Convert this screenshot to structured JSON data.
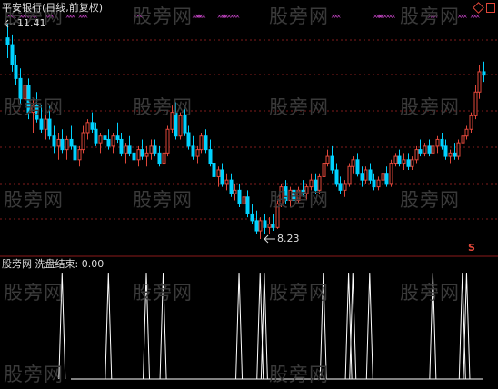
{
  "stock_title": "平安银行(日线,前复权)",
  "watermark": "股旁网",
  "indicator_label": "股旁网 洗盘结束: 0.00",
  "price_high_label": "11.41",
  "price_low_label": "8.23",
  "price_high": 11.41,
  "price_low": 8.23,
  "signal_marker": "S",
  "colors": {
    "up": "#e0473a",
    "down": "#00d2ff",
    "signal_top": "#d34bd3",
    "grid": "#7f1b1b",
    "indicator_line": "#ffffff",
    "watermark": "#3a3a3a"
  },
  "icons": [
    "diamond-icon",
    "square-icon"
  ],
  "chart_data": {
    "type": "candlestick",
    "title": "平安银行(日线,前复权)",
    "annotations": [
      "11.41",
      "8.23"
    ],
    "candles": [
      [
        11.2,
        11.41,
        10.9,
        11.1
      ],
      [
        11.1,
        11.25,
        10.7,
        10.8
      ],
      [
        10.8,
        10.95,
        10.5,
        10.6
      ],
      [
        10.6,
        10.75,
        10.2,
        10.3
      ],
      [
        10.3,
        10.6,
        10.2,
        10.5
      ],
      [
        10.5,
        10.6,
        10.0,
        10.1
      ],
      [
        10.1,
        10.3,
        9.8,
        10.2
      ],
      [
        10.2,
        10.4,
        9.95,
        10.0
      ],
      [
        10.0,
        10.2,
        9.8,
        9.85
      ],
      [
        9.85,
        10.1,
        9.7,
        10.0
      ],
      [
        10.0,
        10.2,
        9.7,
        9.75
      ],
      [
        9.75,
        9.9,
        9.5,
        9.6
      ],
      [
        9.6,
        9.8,
        9.4,
        9.7
      ],
      [
        9.7,
        9.85,
        9.5,
        9.55
      ],
      [
        9.55,
        9.75,
        9.4,
        9.7
      ],
      [
        9.7,
        9.9,
        9.55,
        9.6
      ],
      [
        9.6,
        9.75,
        9.35,
        9.4
      ],
      [
        9.4,
        9.6,
        9.3,
        9.55
      ],
      [
        9.55,
        9.9,
        9.5,
        9.8
      ],
      [
        9.8,
        10.0,
        9.7,
        9.95
      ],
      [
        9.95,
        10.1,
        9.8,
        9.85
      ],
      [
        9.85,
        9.95,
        9.6,
        9.65
      ],
      [
        9.65,
        9.8,
        9.5,
        9.75
      ],
      [
        9.75,
        9.9,
        9.6,
        9.7
      ],
      [
        9.7,
        9.85,
        9.55,
        9.6
      ],
      [
        9.6,
        9.8,
        9.5,
        9.75
      ],
      [
        9.75,
        9.95,
        9.65,
        9.7
      ],
      [
        9.7,
        9.8,
        9.45,
        9.5
      ],
      [
        9.5,
        9.65,
        9.35,
        9.6
      ],
      [
        9.6,
        9.75,
        9.45,
        9.5
      ],
      [
        9.5,
        9.6,
        9.3,
        9.4
      ],
      [
        9.4,
        9.6,
        9.3,
        9.55
      ],
      [
        9.55,
        9.7,
        9.4,
        9.45
      ],
      [
        9.45,
        9.6,
        9.3,
        9.5
      ],
      [
        9.5,
        9.7,
        9.4,
        9.6
      ],
      [
        9.6,
        9.7,
        9.45,
        9.5
      ],
      [
        9.5,
        9.6,
        9.3,
        9.35
      ],
      [
        9.35,
        9.55,
        9.3,
        9.5
      ],
      [
        9.5,
        9.9,
        9.45,
        9.85
      ],
      [
        9.85,
        10.2,
        9.8,
        10.1
      ],
      [
        10.1,
        10.25,
        9.7,
        9.75
      ],
      [
        9.75,
        10.1,
        9.7,
        10.05
      ],
      [
        10.05,
        10.15,
        9.75,
        9.8
      ],
      [
        9.8,
        9.9,
        9.55,
        9.6
      ],
      [
        9.6,
        9.75,
        9.4,
        9.45
      ],
      [
        9.45,
        9.6,
        9.35,
        9.55
      ],
      [
        9.55,
        9.8,
        9.5,
        9.75
      ],
      [
        9.75,
        9.85,
        9.5,
        9.55
      ],
      [
        9.55,
        9.7,
        9.3,
        9.35
      ],
      [
        9.35,
        9.5,
        9.1,
        9.15
      ],
      [
        9.15,
        9.3,
        9.0,
        9.25
      ],
      [
        9.25,
        9.35,
        9.0,
        9.05
      ],
      [
        9.05,
        9.2,
        8.95,
        9.1
      ],
      [
        9.1,
        9.2,
        8.85,
        8.9
      ],
      [
        8.9,
        9.05,
        8.8,
        8.95
      ],
      [
        8.95,
        9.05,
        8.7,
        8.75
      ],
      [
        8.75,
        8.9,
        8.6,
        8.85
      ],
      [
        8.85,
        8.95,
        8.55,
        8.6
      ],
      [
        8.6,
        8.75,
        8.45,
        8.5
      ],
      [
        8.5,
        8.65,
        8.3,
        8.35
      ],
      [
        8.35,
        8.55,
        8.23,
        8.5
      ],
      [
        8.5,
        8.6,
        8.3,
        8.4
      ],
      [
        8.4,
        8.55,
        8.3,
        8.45
      ],
      [
        8.45,
        8.6,
        8.35,
        8.4
      ],
      [
        8.4,
        8.8,
        8.38,
        8.75
      ],
      [
        8.75,
        9.05,
        8.7,
        9.0
      ],
      [
        9.0,
        9.1,
        8.75,
        8.8
      ],
      [
        8.8,
        9.0,
        8.7,
        8.95
      ],
      [
        8.95,
        9.05,
        8.75,
        8.8
      ],
      [
        8.8,
        9.0,
        8.75,
        8.95
      ],
      [
        8.95,
        9.1,
        8.85,
        8.9
      ],
      [
        8.9,
        9.05,
        8.8,
        9.0
      ],
      [
        9.0,
        9.2,
        8.95,
        9.1
      ],
      [
        9.1,
        9.2,
        8.9,
        8.95
      ],
      [
        8.95,
        9.2,
        8.9,
        9.15
      ],
      [
        9.15,
        9.4,
        9.1,
        9.35
      ],
      [
        9.35,
        9.55,
        9.3,
        9.45
      ],
      [
        9.45,
        9.6,
        9.2,
        9.25
      ],
      [
        9.25,
        9.35,
        9.0,
        9.05
      ],
      [
        9.05,
        9.15,
        8.9,
        8.95
      ],
      [
        8.95,
        9.1,
        8.85,
        9.05
      ],
      [
        9.05,
        9.35,
        9.0,
        9.3
      ],
      [
        9.3,
        9.45,
        9.2,
        9.4
      ],
      [
        9.4,
        9.5,
        9.15,
        9.2
      ],
      [
        9.2,
        9.3,
        9.0,
        9.1
      ],
      [
        9.1,
        9.3,
        9.05,
        9.25
      ],
      [
        9.25,
        9.35,
        9.05,
        9.1
      ],
      [
        9.1,
        9.2,
        8.95,
        9.0
      ],
      [
        9.0,
        9.15,
        8.95,
        9.1
      ],
      [
        9.1,
        9.25,
        9.05,
        9.2
      ],
      [
        9.2,
        9.3,
        9.0,
        9.05
      ],
      [
        9.05,
        9.4,
        9.0,
        9.35
      ],
      [
        9.35,
        9.5,
        9.3,
        9.45
      ],
      [
        9.45,
        9.55,
        9.3,
        9.35
      ],
      [
        9.35,
        9.5,
        9.25,
        9.4
      ],
      [
        9.4,
        9.5,
        9.25,
        9.3
      ],
      [
        9.3,
        9.45,
        9.25,
        9.4
      ],
      [
        9.4,
        9.6,
        9.35,
        9.55
      ],
      [
        9.55,
        9.7,
        9.45,
        9.5
      ],
      [
        9.5,
        9.65,
        9.45,
        9.6
      ],
      [
        9.6,
        9.7,
        9.45,
        9.5
      ],
      [
        9.5,
        9.65,
        9.4,
        9.6
      ],
      [
        9.6,
        9.75,
        9.5,
        9.7
      ],
      [
        9.7,
        9.8,
        9.55,
        9.6
      ],
      [
        9.6,
        9.7,
        9.4,
        9.45
      ],
      [
        9.45,
        9.55,
        9.35,
        9.5
      ],
      [
        9.5,
        9.65,
        9.4,
        9.45
      ],
      [
        9.45,
        9.7,
        9.4,
        9.65
      ],
      [
        9.65,
        9.8,
        9.6,
        9.75
      ],
      [
        9.75,
        9.9,
        9.7,
        9.85
      ],
      [
        9.85,
        10.1,
        9.8,
        10.05
      ],
      [
        10.05,
        10.5,
        10.0,
        10.4
      ],
      [
        10.4,
        10.8,
        10.3,
        10.7
      ],
      [
        10.7,
        10.85,
        10.55,
        10.65
      ]
    ],
    "indicator_spikes": [
      13,
      24,
      33,
      37,
      55,
      60,
      61,
      75,
      81,
      82,
      86,
      101,
      108,
      109
    ],
    "top_signal_groups": [
      1,
      4,
      6,
      10,
      15,
      18,
      31,
      45,
      46,
      51,
      52,
      54,
      78,
      88,
      89,
      91,
      101,
      108,
      111
    ]
  }
}
